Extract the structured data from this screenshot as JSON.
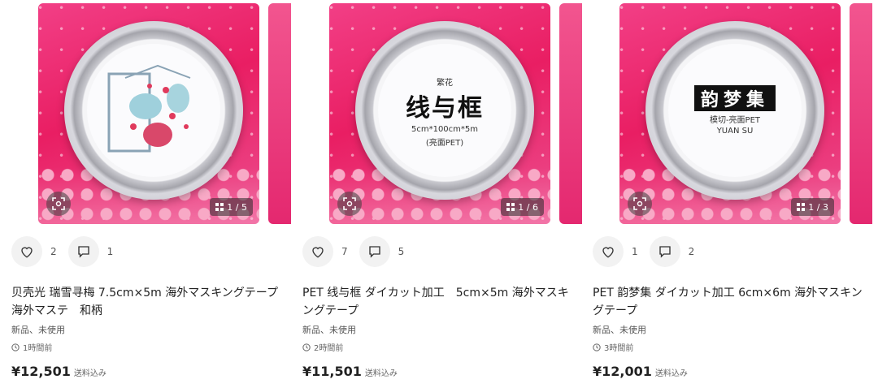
{
  "items": [
    {
      "title": "贝壳光 瑞雪寻梅 7.5cm×5m 海外マスキングテープ　海外マステ　和柄",
      "likes": "2",
      "comments": "1",
      "photo_counter": "1 / 5",
      "condition": "新品、未使用",
      "time": "1時間前",
      "price": "¥12,501",
      "shipping": "送料込み"
    },
    {
      "title": "PET 线与框 ダイカット加工　5cm×5m 海外マスキングテープ",
      "likes": "7",
      "comments": "5",
      "photo_counter": "1 / 6",
      "condition": "新品、未使用",
      "time": "2時間前",
      "price": "¥11,501",
      "shipping": "送料込み",
      "tape_label": {
        "top": "繁花",
        "main": "线与框",
        "size": "5cm*100cm*5m",
        "finish": "(亮面PET)"
      }
    },
    {
      "title": "PET 韵梦集 ダイカット加工 6cm×6m 海外マスキングテープ",
      "likes": "1",
      "comments": "2",
      "photo_counter": "1 / 3",
      "condition": "新品、未使用",
      "time": "3時間前",
      "price": "¥12,001",
      "shipping": "送料込み",
      "tape_label": {
        "main": "韵梦集",
        "sub": "模切-亮面PET",
        "brand": "YUAN SU"
      }
    }
  ],
  "colors": {
    "photo_bg": "#e91e63",
    "button_bg": "#f2f2f2"
  }
}
